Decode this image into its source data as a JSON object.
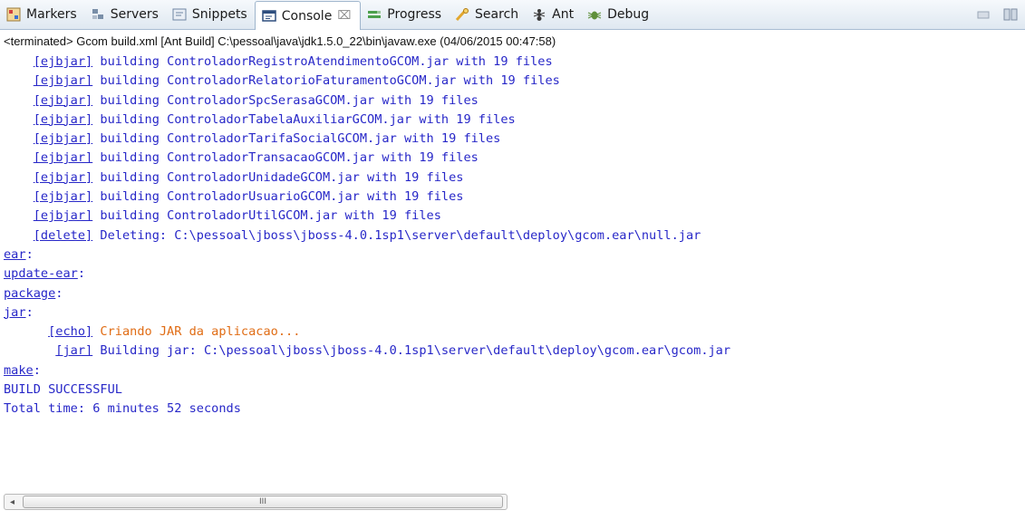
{
  "tabs": [
    {
      "label": "Markers",
      "icon": "markers-icon"
    },
    {
      "label": "Servers",
      "icon": "servers-icon"
    },
    {
      "label": "Snippets",
      "icon": "snippets-icon"
    },
    {
      "label": "Console",
      "icon": "console-icon",
      "active": true,
      "close_glyph": "⌧"
    },
    {
      "label": "Progress",
      "icon": "progress-icon"
    },
    {
      "label": "Search",
      "icon": "search-icon"
    },
    {
      "label": "Ant",
      "icon": "ant-icon"
    },
    {
      "label": "Debug",
      "icon": "debug-icon"
    }
  ],
  "window_controls": {
    "minimize_icon": "minimize-icon",
    "maximize_icon": "maximize-icon"
  },
  "description": "<terminated> Gcom build.xml [Ant Build] C:\\pessoal\\java\\jdk1.5.0_22\\bin\\javaw.exe (04/06/2015 00:47:58)",
  "console": {
    "lines": [
      {
        "indent": "    ",
        "task": "[ejbjar]",
        "text": " building ControladorRegistroAtendimentoGCOM.jar with 19 files"
      },
      {
        "indent": "    ",
        "task": "[ejbjar]",
        "text": " building ControladorRelatorioFaturamentoGCOM.jar with 19 files"
      },
      {
        "indent": "    ",
        "task": "[ejbjar]",
        "text": " building ControladorSpcSerasaGCOM.jar with 19 files"
      },
      {
        "indent": "    ",
        "task": "[ejbjar]",
        "text": " building ControladorTabelaAuxiliarGCOM.jar with 19 files"
      },
      {
        "indent": "    ",
        "task": "[ejbjar]",
        "text": " building ControladorTarifaSocialGCOM.jar with 19 files"
      },
      {
        "indent": "    ",
        "task": "[ejbjar]",
        "text": " building ControladorTransacaoGCOM.jar with 19 files"
      },
      {
        "indent": "    ",
        "task": "[ejbjar]",
        "text": " building ControladorUnidadeGCOM.jar with 19 files"
      },
      {
        "indent": "    ",
        "task": "[ejbjar]",
        "text": " building ControladorUsuarioGCOM.jar with 19 files"
      },
      {
        "indent": "    ",
        "task": "[ejbjar]",
        "text": " building ControladorUtilGCOM.jar with 19 files"
      },
      {
        "indent": "    ",
        "task": "[delete]",
        "text": " Deleting: C:\\pessoal\\jboss\\jboss-4.0.1sp1\\server\\default\\deploy\\gcom.ear\\null.jar"
      },
      {
        "target": "ear",
        "text": ":"
      },
      {
        "target": "update-ear",
        "text": ":"
      },
      {
        "target": "package",
        "text": ":"
      },
      {
        "target": "jar",
        "text": ":"
      },
      {
        "indent": "      ",
        "task": "[echo]",
        "text": " Criando JAR da aplicacao...",
        "orange": true
      },
      {
        "indent": "       ",
        "task": "[jar]",
        "text": " Building jar: C:\\pessoal\\jboss\\jboss-4.0.1sp1\\server\\default\\deploy\\gcom.ear\\gcom.jar"
      },
      {
        "target": "make",
        "text": ":"
      },
      {
        "text": "BUILD SUCCESSFUL"
      },
      {
        "text": "Total time: 6 minutes 52 seconds"
      }
    ]
  },
  "scrollbar": {
    "left_arrow": "◂",
    "grip": "III"
  },
  "colors": {
    "output_blue": "#2727c8",
    "echo_orange": "#e06c14"
  }
}
